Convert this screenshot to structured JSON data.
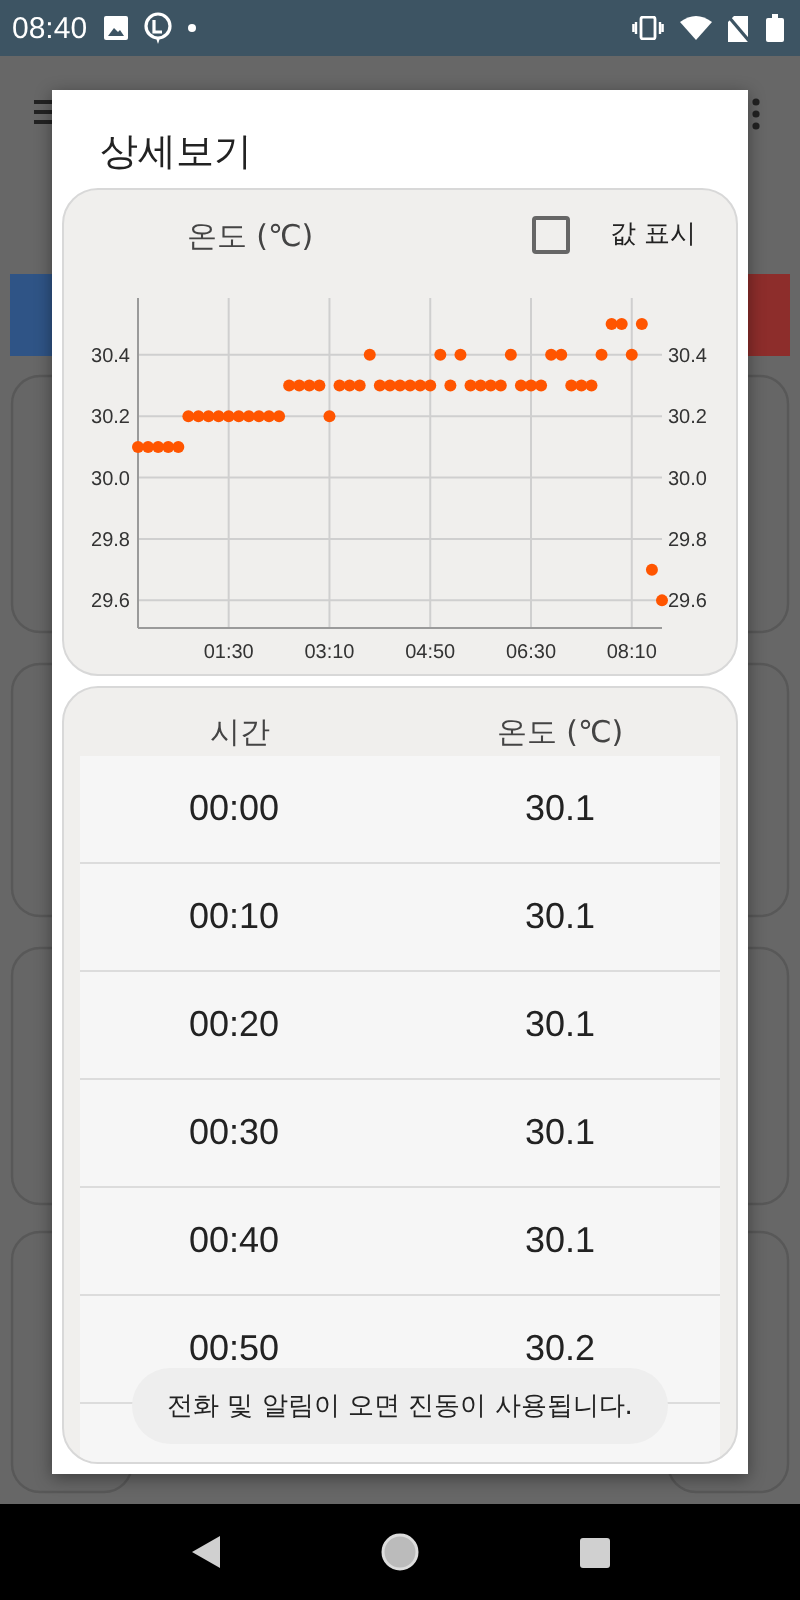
{
  "status_bar": {
    "time": "08:40"
  },
  "dialog": {
    "title": "상세보기",
    "chart": {
      "show_values": {
        "label": "값 표시",
        "checked": false
      },
      "chart_data": {
        "type": "scatter",
        "title": "온도 (℃)",
        "grid": true,
        "x": [
          0,
          10,
          20,
          30,
          40,
          50,
          60,
          70,
          80,
          90,
          100,
          110,
          120,
          130,
          140,
          150,
          160,
          170,
          180,
          190,
          200,
          210,
          220,
          230,
          240,
          250,
          260,
          270,
          280,
          290,
          300,
          310,
          320,
          330,
          340,
          350,
          360,
          370,
          380,
          390,
          400,
          410,
          420,
          430,
          440,
          450,
          460,
          470,
          480,
          490,
          500,
          510,
          520
        ],
        "series": [
          {
            "color": "#ff5500",
            "values": [
              30.1,
              30.1,
              30.1,
              30.1,
              30.1,
              30.2,
              30.2,
              30.2,
              30.2,
              30.2,
              30.2,
              30.2,
              30.2,
              30.2,
              30.2,
              30.3,
              30.3,
              30.3,
              30.3,
              30.2,
              30.3,
              30.3,
              30.3,
              30.4,
              30.3,
              30.3,
              30.3,
              30.3,
              30.3,
              30.3,
              30.4,
              30.3,
              30.4,
              30.3,
              30.3,
              30.3,
              30.3,
              30.4,
              30.3,
              30.3,
              30.3,
              30.4,
              30.4,
              30.3,
              30.3,
              30.3,
              30.4,
              30.5,
              30.5,
              30.4,
              30.5,
              29.7,
              29.6
            ]
          }
        ],
        "xlim": [
          0,
          520
        ],
        "ylim": [
          29.51,
          30.585
        ],
        "xticks": [
          {
            "value": 90,
            "label": "01:30"
          },
          {
            "value": 190,
            "label": "03:10"
          },
          {
            "value": 290,
            "label": "04:50"
          },
          {
            "value": 390,
            "label": "06:30"
          },
          {
            "value": 490,
            "label": "08:10"
          }
        ],
        "yticks": [
          {
            "value": 29.6,
            "label": "29.6"
          },
          {
            "value": 29.8,
            "label": "29.8"
          },
          {
            "value": 30.0,
            "label": "30.0"
          },
          {
            "value": 30.2,
            "label": "30.2"
          },
          {
            "value": 30.4,
            "label": "30.4"
          }
        ]
      }
    },
    "table": {
      "columns": [
        "시간",
        "온도 (℃)"
      ],
      "rows": [
        [
          "00:00",
          "30.1"
        ],
        [
          "00:10",
          "30.1"
        ],
        [
          "00:20",
          "30.1"
        ],
        [
          "00:30",
          "30.1"
        ],
        [
          "00:40",
          "30.1"
        ],
        [
          "00:50",
          "30.2"
        ]
      ]
    }
  },
  "toast": "전화 및 알림이 오면 진동이 사용됩니다."
}
